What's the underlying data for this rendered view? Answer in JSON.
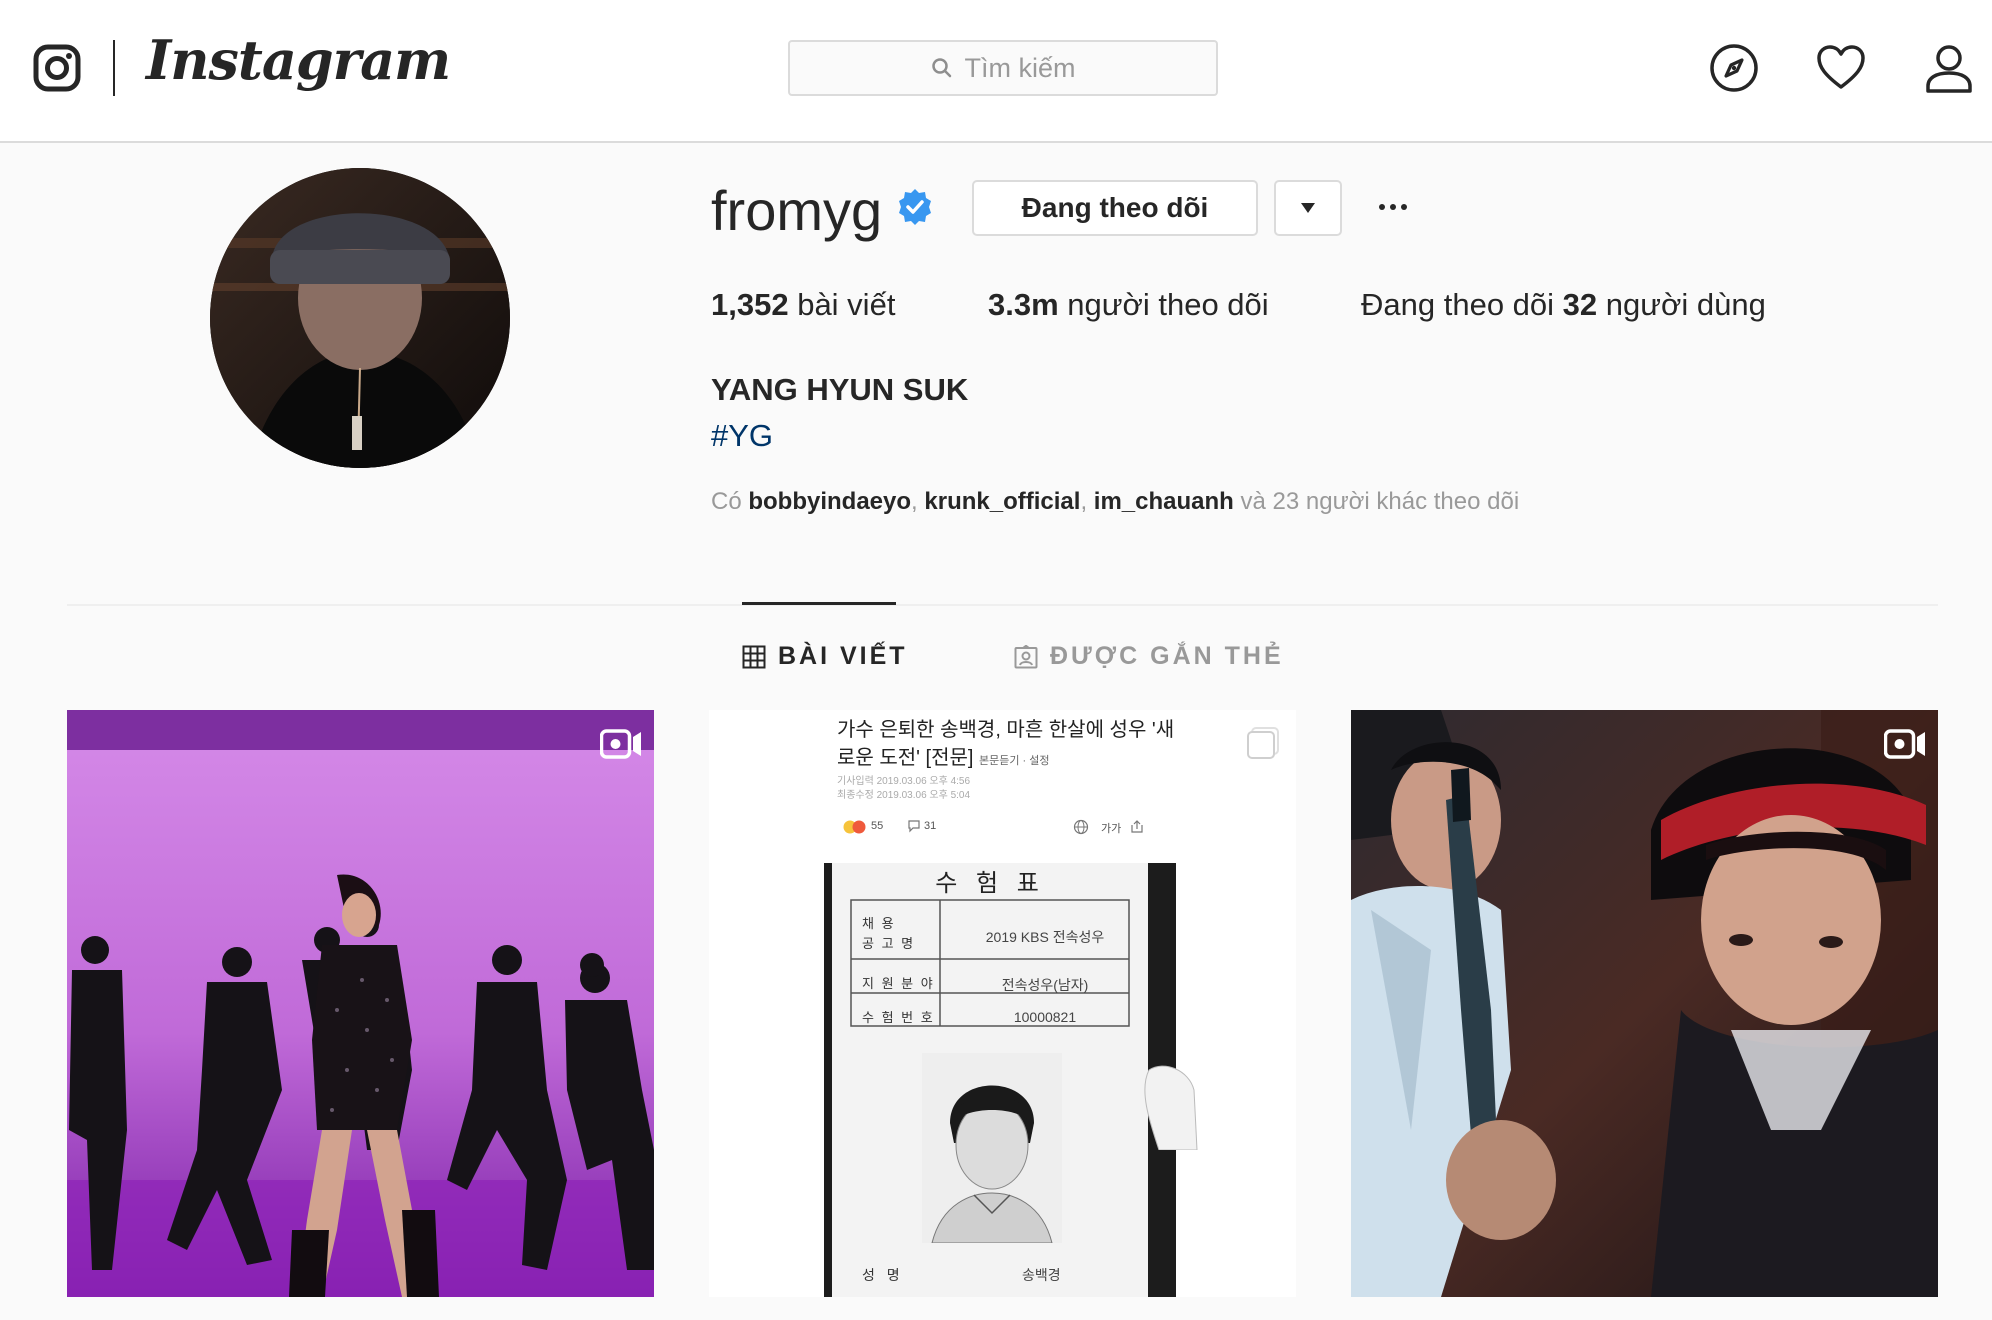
{
  "header": {
    "logo_icon": "instagram-camera-icon",
    "wordmark": "Instagram",
    "search_placeholder": "Tìm kiếm",
    "nav_icons": [
      "compass-icon",
      "heart-icon",
      "user-icon"
    ]
  },
  "profile": {
    "username": "fromyg",
    "verified": true,
    "follow_button": "Đang theo dõi",
    "posts_count": "1,352",
    "posts_label": "bài viết",
    "followers_count": "3.3m",
    "followers_label": "người theo dõi",
    "following_prefix": "Đang theo dõi",
    "following_count": "32",
    "following_suffix": "người dùng",
    "full_name": "YANG HYUN SUK",
    "bio_hashtag": "#YG",
    "followed_by_prefix": "Có",
    "followed_by_users": [
      "bobbyindaeyo",
      "krunk_official",
      "im_chauanh"
    ],
    "followed_by_separator": ",",
    "followed_by_suffix": "và 23 người khác theo dõi"
  },
  "tabs": {
    "posts": "BÀI VIẾT",
    "tagged": "ĐƯỢC GẮN THẺ",
    "active": "posts"
  },
  "posts": [
    {
      "type": "video"
    },
    {
      "type": "carousel",
      "news_title_line1": "가수 은퇴한 송백경, 마흔 한살에 성우 '새",
      "news_title_line2": "로운 도전' [전문]",
      "news_tools": "본문듣기 · 설정",
      "meta_line1": "기사입력 2019.03.06 오후 4:56",
      "meta_line2": "최종수정 2019.03.06 오후 5:04",
      "reactions": "55",
      "comments": "31",
      "font_tool": "가가",
      "doc_title": "수 험 표",
      "doc_rows": [
        {
          "label": "채 용",
          "label2": "공 고 명",
          "value": "2019 KBS 전속성우"
        },
        {
          "label": "지 원 분 야",
          "value": "전속성우(남자)"
        },
        {
          "label": "수 험 번 호",
          "value": "10000821"
        }
      ],
      "doc_name_label": "성 명",
      "doc_name_value": "송백경"
    },
    {
      "type": "video"
    }
  ]
}
